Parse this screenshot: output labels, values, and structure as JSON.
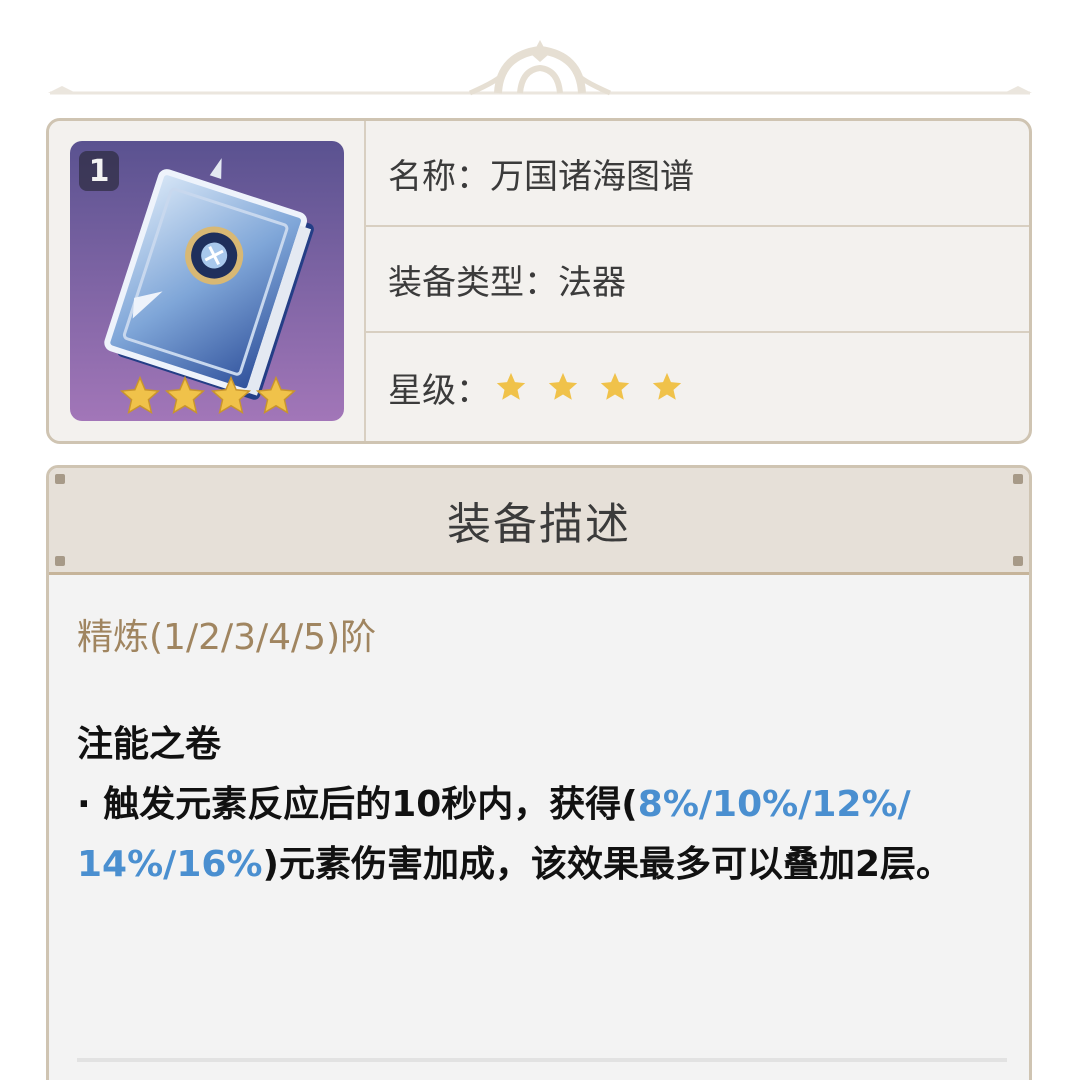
{
  "info": {
    "refine_level": "1",
    "rarity_stars": 4,
    "name_label": "名称：",
    "name_value": "万国诸海图谱",
    "type_label": "装备类型：",
    "type_value": "法器",
    "rarity_label": "星级："
  },
  "description": {
    "header": "装备描述",
    "refine_label": "精炼(1/2/3/4/5)阶",
    "skill_name": "注能之卷",
    "text_1": "· 触发元素反应后的10秒内，获得(",
    "highlight_1": "8%/10%/12%/",
    "highlight_2": "14%/16%",
    "text_2": ")元素伤害加成，该效果最多可以叠加2层。"
  },
  "colors": {
    "star": "#f0c24a",
    "highlight": "#4a8fd0",
    "refine_text": "#a08560",
    "card_border": "#cfc4b2"
  },
  "icons": [
    "catalyst-book-icon",
    "star-icon"
  ]
}
